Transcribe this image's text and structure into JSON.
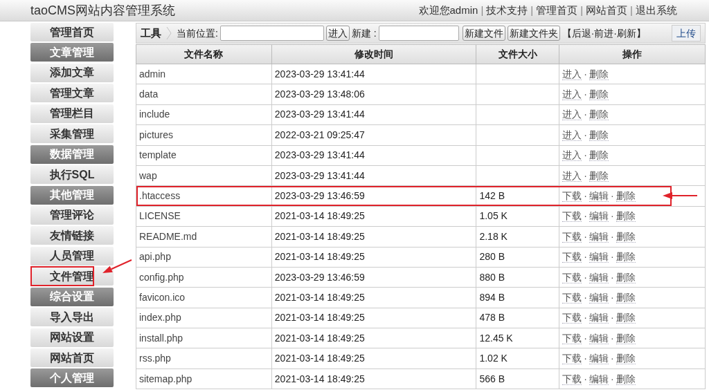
{
  "header": {
    "title": "taoCMS网站内容管理系统",
    "welcome": "欢迎您admin",
    "separator": "|",
    "links": [
      "技术支持",
      "管理首页",
      "网站首页",
      "退出系统"
    ]
  },
  "sidebar": {
    "items": [
      {
        "label": "管理首页",
        "kind": "link",
        "highlighted": false
      },
      {
        "label": "文章管理",
        "kind": "section",
        "highlighted": false
      },
      {
        "label": "添加文章",
        "kind": "link",
        "highlighted": false
      },
      {
        "label": "管理文章",
        "kind": "link",
        "highlighted": false
      },
      {
        "label": "管理栏目",
        "kind": "link",
        "highlighted": false
      },
      {
        "label": "采集管理",
        "kind": "link",
        "highlighted": false
      },
      {
        "label": "数据管理",
        "kind": "section",
        "highlighted": false
      },
      {
        "label": "执行SQL",
        "kind": "link",
        "highlighted": false
      },
      {
        "label": "其他管理",
        "kind": "section",
        "highlighted": false
      },
      {
        "label": "管理评论",
        "kind": "link",
        "highlighted": false
      },
      {
        "label": "友情链接",
        "kind": "link",
        "highlighted": false
      },
      {
        "label": "人员管理",
        "kind": "link",
        "highlighted": false
      },
      {
        "label": "文件管理",
        "kind": "link",
        "highlighted": true
      },
      {
        "label": "综合设置",
        "kind": "section",
        "highlighted": false
      },
      {
        "label": "导入导出",
        "kind": "link",
        "highlighted": false
      },
      {
        "label": "网站设置",
        "kind": "link",
        "highlighted": false
      },
      {
        "label": "网站首页",
        "kind": "link",
        "highlighted": false
      },
      {
        "label": "个人管理",
        "kind": "section",
        "highlighted": false
      }
    ]
  },
  "toolbar": {
    "title": "工具",
    "location_label": "当前位置:",
    "enter_button": "进入",
    "new_label": "新建 :",
    "new_file_button": "新建文件",
    "new_folder_button": "新建文件夹",
    "nav_links": "【后退·前进·刷新】",
    "upload_button": "上传"
  },
  "table": {
    "columns": [
      "文件名称",
      "修改时间",
      "文件大小",
      "操作"
    ],
    "separator": "·",
    "rows": [
      {
        "name": "admin",
        "modified": "2023-03-29 13:41:44",
        "actions": [
          "进入",
          "删除"
        ],
        "highlighted": false
      },
      {
        "name": "data",
        "modified": "2023-03-29 13:48:06",
        "actions": [
          "进入",
          "删除"
        ],
        "highlighted": false
      },
      {
        "name": "include",
        "modified": "2023-03-29 13:41:44",
        "actions": [
          "进入",
          "删除"
        ],
        "highlighted": false
      },
      {
        "name": "pictures",
        "modified": "2022-03-21 09:25:47",
        "actions": [
          "进入",
          "删除"
        ],
        "highlighted": false
      },
      {
        "name": "template",
        "modified": "2023-03-29 13:41:44",
        "actions": [
          "进入",
          "删除"
        ],
        "highlighted": false
      },
      {
        "name": "wap",
        "modified": "2023-03-29 13:41:44",
        "actions": [
          "进入",
          "删除"
        ],
        "highlighted": false
      },
      {
        "name": ".htaccess",
        "modified": "2023-03-29 13:46:59",
        "size": "142 B",
        "actions": [
          "下载",
          "编辑",
          "删除"
        ],
        "highlighted": true
      },
      {
        "name": "LICENSE",
        "modified": "2021-03-14 18:49:25",
        "size": "1.05 K",
        "actions": [
          "下载",
          "编辑",
          "删除"
        ],
        "highlighted": false
      },
      {
        "name": "README.md",
        "modified": "2021-03-14 18:49:25",
        "size": "2.18 K",
        "actions": [
          "下载",
          "编辑",
          "删除"
        ],
        "highlighted": false
      },
      {
        "name": "api.php",
        "modified": "2021-03-14 18:49:25",
        "size": "280 B",
        "actions": [
          "下载",
          "编辑",
          "删除"
        ],
        "highlighted": false
      },
      {
        "name": "config.php",
        "modified": "2023-03-29 13:46:59",
        "size": "880 B",
        "actions": [
          "下载",
          "编辑",
          "删除"
        ],
        "highlighted": false
      },
      {
        "name": "favicon.ico",
        "modified": "2021-03-14 18:49:25",
        "size": "894 B",
        "actions": [
          "下载",
          "编辑",
          "删除"
        ],
        "highlighted": false
      },
      {
        "name": "index.php",
        "modified": "2021-03-14 18:49:25",
        "size": "478 B",
        "actions": [
          "下载",
          "编辑",
          "删除"
        ],
        "highlighted": false
      },
      {
        "name": "install.php",
        "modified": "2021-03-14 18:49:25",
        "size": "12.45 K",
        "actions": [
          "下载",
          "编辑",
          "删除"
        ],
        "highlighted": false
      },
      {
        "name": "rss.php",
        "modified": "2021-03-14 18:49:25",
        "size": "1.02 K",
        "actions": [
          "下载",
          "编辑",
          "删除"
        ],
        "highlighted": false
      },
      {
        "name": "sitemap.php",
        "modified": "2021-03-14 18:49:25",
        "size": "566 B",
        "actions": [
          "下载",
          "编辑",
          "删除"
        ],
        "highlighted": false
      }
    ]
  }
}
